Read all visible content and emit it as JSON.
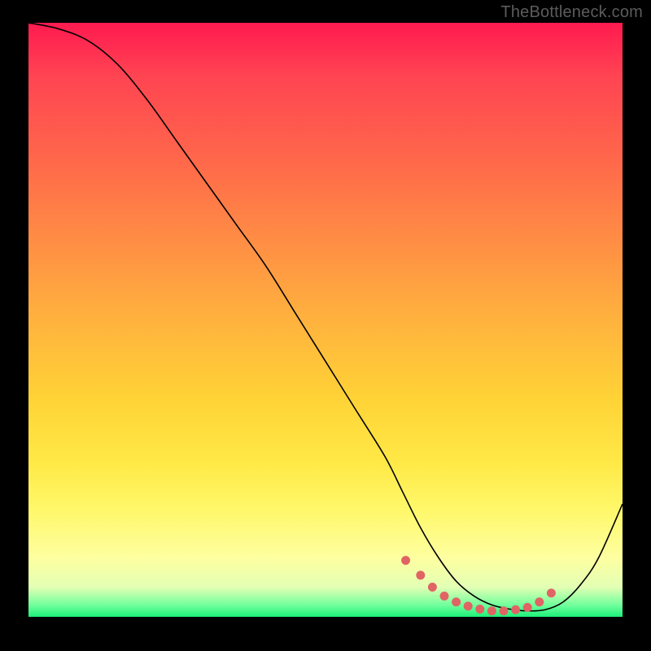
{
  "watermark": "TheBottleneck.com",
  "chart_data": {
    "type": "line",
    "title": "",
    "xlabel": "",
    "ylabel": "",
    "xlim": [
      0,
      100
    ],
    "ylim": [
      0,
      100
    ],
    "series": [
      {
        "name": "curve",
        "x": [
          0,
          5,
          10,
          15,
          20,
          25,
          30,
          35,
          40,
          45,
          50,
          55,
          60,
          63,
          66,
          69,
          72,
          75,
          78,
          81,
          84,
          87,
          90,
          93,
          96,
          100
        ],
        "y": [
          100,
          99,
          97,
          93,
          87,
          80,
          73,
          66,
          59,
          51,
          43,
          35,
          27,
          21,
          15,
          10,
          6,
          3.5,
          2,
          1.3,
          1.0,
          1.2,
          2.5,
          5.5,
          10,
          19
        ]
      }
    ],
    "markers": {
      "name": "highlight-dots",
      "color": "#e06464",
      "x": [
        63.5,
        66,
        68,
        70,
        72,
        74,
        76,
        78,
        80,
        82,
        84,
        86,
        88
      ],
      "y": [
        9.5,
        7,
        5,
        3.5,
        2.5,
        1.8,
        1.3,
        1.0,
        1.0,
        1.2,
        1.6,
        2.5,
        4.0
      ]
    },
    "gradient_stops": [
      {
        "pos": 0,
        "color": "#ff1a50"
      },
      {
        "pos": 9,
        "color": "#ff4452"
      },
      {
        "pos": 24,
        "color": "#ff6a4a"
      },
      {
        "pos": 37,
        "color": "#ff8e44"
      },
      {
        "pos": 50,
        "color": "#ffb23e"
      },
      {
        "pos": 63,
        "color": "#ffd236"
      },
      {
        "pos": 74,
        "color": "#ffe946"
      },
      {
        "pos": 82,
        "color": "#fff86a"
      },
      {
        "pos": 90,
        "color": "#feffa0"
      },
      {
        "pos": 95,
        "color": "#e3ffb4"
      },
      {
        "pos": 98,
        "color": "#72ff9c"
      },
      {
        "pos": 100,
        "color": "#1cf07a"
      }
    ]
  }
}
